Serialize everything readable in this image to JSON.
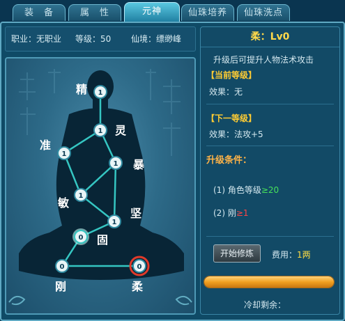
{
  "tabs": [
    {
      "label": "装　备"
    },
    {
      "label": "属　性"
    },
    {
      "label": "元神"
    },
    {
      "label": "仙珠培养"
    },
    {
      "label": "仙珠洗点"
    }
  ],
  "info": {
    "profession_label": "职业：无职业",
    "level_label": "等级：50",
    "realm_label": "仙境：缥缈峰"
  },
  "nodes": [
    {
      "label": "精",
      "level": "1"
    },
    {
      "label": "灵",
      "level": "1"
    },
    {
      "label": "准",
      "level": "1"
    },
    {
      "label": "暴",
      "level": "1"
    },
    {
      "label": "敏",
      "level": "1"
    },
    {
      "label": "坚",
      "level": "1"
    },
    {
      "label": "固",
      "level": "0"
    },
    {
      "label": "刚",
      "level": "0"
    },
    {
      "label": "柔",
      "level": "0"
    }
  ],
  "detail": {
    "title": "柔：Lv0",
    "description": "升级后可提升人物法术攻击",
    "current_header": "【当前等级】",
    "current_effect": "效果：无",
    "next_header": "【下一等级】",
    "next_effect": "效果：法攻+5",
    "conditions_header": "升级条件：",
    "cond1_prefix": "(1) 角色等级",
    "cond1_value": "≥20",
    "cond2_prefix": "(2) 刚",
    "cond2_value": "≥1",
    "start_button": "开始修炼",
    "cost_label": "费用：",
    "cost_value": "1两",
    "cooldown_label": "冷却剩余：",
    "cooldown_progress": 1.0
  },
  "colors": {
    "accent_gold": "#ffd94a",
    "condition_met": "#47e15a",
    "condition_unmet": "#ff4444",
    "selected_node_ring": "#e03a2a"
  }
}
